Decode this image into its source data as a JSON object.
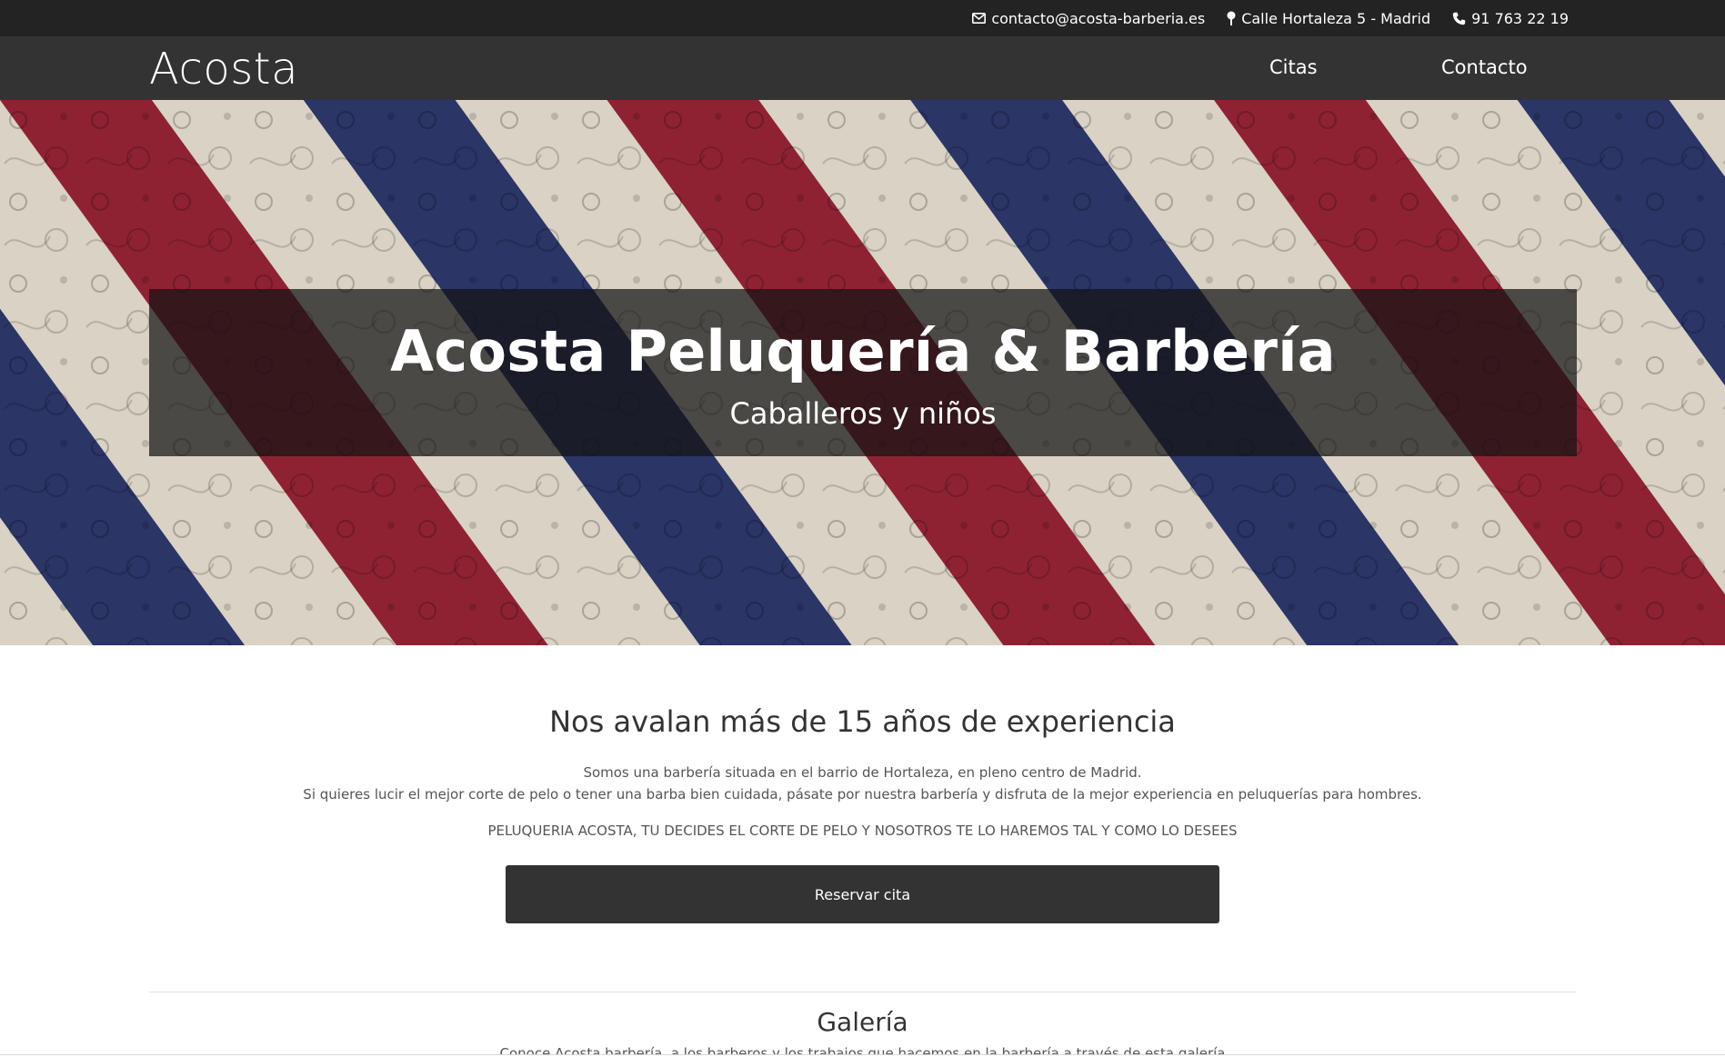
{
  "topbar": {
    "email": "contacto@acosta-barberia.es",
    "address": "Calle Hortaleza 5 - Madrid",
    "phone": "91 763 22 19",
    "icons": [
      "envelope-icon",
      "map-marker-icon",
      "phone-icon"
    ]
  },
  "navbar": {
    "brand": "Acosta",
    "links": [
      "Citas",
      "Contacto"
    ]
  },
  "hero": {
    "title": "Acosta Peluquería & Barbería",
    "subtitle": "Caballeros y niños",
    "stripe_colors": [
      "#8e2233",
      "#d9d2c5",
      "#2b3566"
    ]
  },
  "about": {
    "heading": "Nos avalan más de 15 años de experiencia",
    "line1": "Somos una barbería situada en el barrio de Hortaleza, en pleno centro de Madrid.",
    "line2": "Si quieres lucir el mejor corte de pelo o tener una barba bien cuidada, pásate por nuestra barbería y disfruta de la mejor experiencia en peluquerías para hombres.",
    "tagline": "PELUQUERIA ACOSTA, TU DECIDES EL CORTE DE PELO Y NOSOTROS TE LO HAREMOS TAL Y COMO LO DESEES",
    "button_label": "Reservar cita"
  },
  "gallery": {
    "heading": "Galería",
    "text": "Conoce Acosta barbería, a los barberos y los trabajos que hacemos en la barbería a través de esta galería"
  },
  "colors": {
    "topbar_bg": "#232323",
    "navbar_bg": "#333333",
    "button_bg": "#333333"
  }
}
